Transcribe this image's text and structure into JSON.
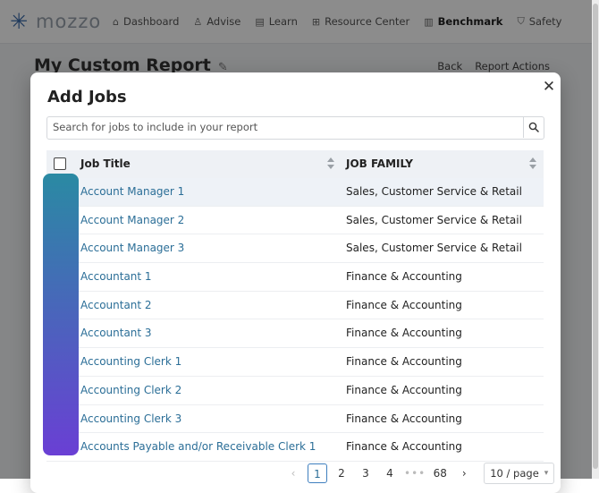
{
  "app": {
    "logo_text": "mozzo",
    "nav": [
      {
        "label": "Dashboard",
        "icon": "home-icon"
      },
      {
        "label": "Advise",
        "icon": "person-icon"
      },
      {
        "label": "Learn",
        "icon": "book-icon"
      },
      {
        "label": "Resource Center",
        "icon": "grid-icon"
      },
      {
        "label": "Benchmark",
        "icon": "chart-icon",
        "active": true
      },
      {
        "label": "Safety",
        "icon": "shield-icon"
      }
    ],
    "page_title": "My Custom Report",
    "actions": {
      "back": "Back",
      "report_actions": "Report Actions"
    }
  },
  "modal": {
    "title": "Add Jobs",
    "close_glyph": "✕",
    "search": {
      "placeholder": "Search for jobs to include in your report",
      "value": ""
    },
    "table": {
      "columns": {
        "title": "Job Title",
        "family": "JOB FAMILY"
      },
      "rows": [
        {
          "title": "Account Manager 1",
          "family": "Sales, Customer Service & Retail",
          "highlighted": true
        },
        {
          "title": "Account Manager 2",
          "family": "Sales, Customer Service & Retail"
        },
        {
          "title": "Account Manager 3",
          "family": "Sales, Customer Service & Retail"
        },
        {
          "title": "Accountant 1",
          "family": "Finance & Accounting"
        },
        {
          "title": "Accountant 2",
          "family": "Finance & Accounting"
        },
        {
          "title": "Accountant 3",
          "family": "Finance & Accounting"
        },
        {
          "title": "Accounting Clerk 1",
          "family": "Finance & Accounting"
        },
        {
          "title": "Accounting Clerk 2",
          "family": "Finance & Accounting"
        },
        {
          "title": "Accounting Clerk 3",
          "family": "Finance & Accounting"
        },
        {
          "title": "Accounts Payable and/or Receivable Clerk 1",
          "family": "Finance & Accounting"
        }
      ]
    },
    "pagination": {
      "prev": "‹",
      "pages": [
        "1",
        "2",
        "3",
        "4"
      ],
      "current": "1",
      "ellipsis": "•••",
      "last": "68",
      "next": "›",
      "page_size": "10 / page"
    }
  },
  "colors": {
    "link": "#2b6e97",
    "header_bg": "#eef1f5",
    "annotation_start": "#2a8aa3",
    "annotation_end": "#6a3fd4"
  }
}
